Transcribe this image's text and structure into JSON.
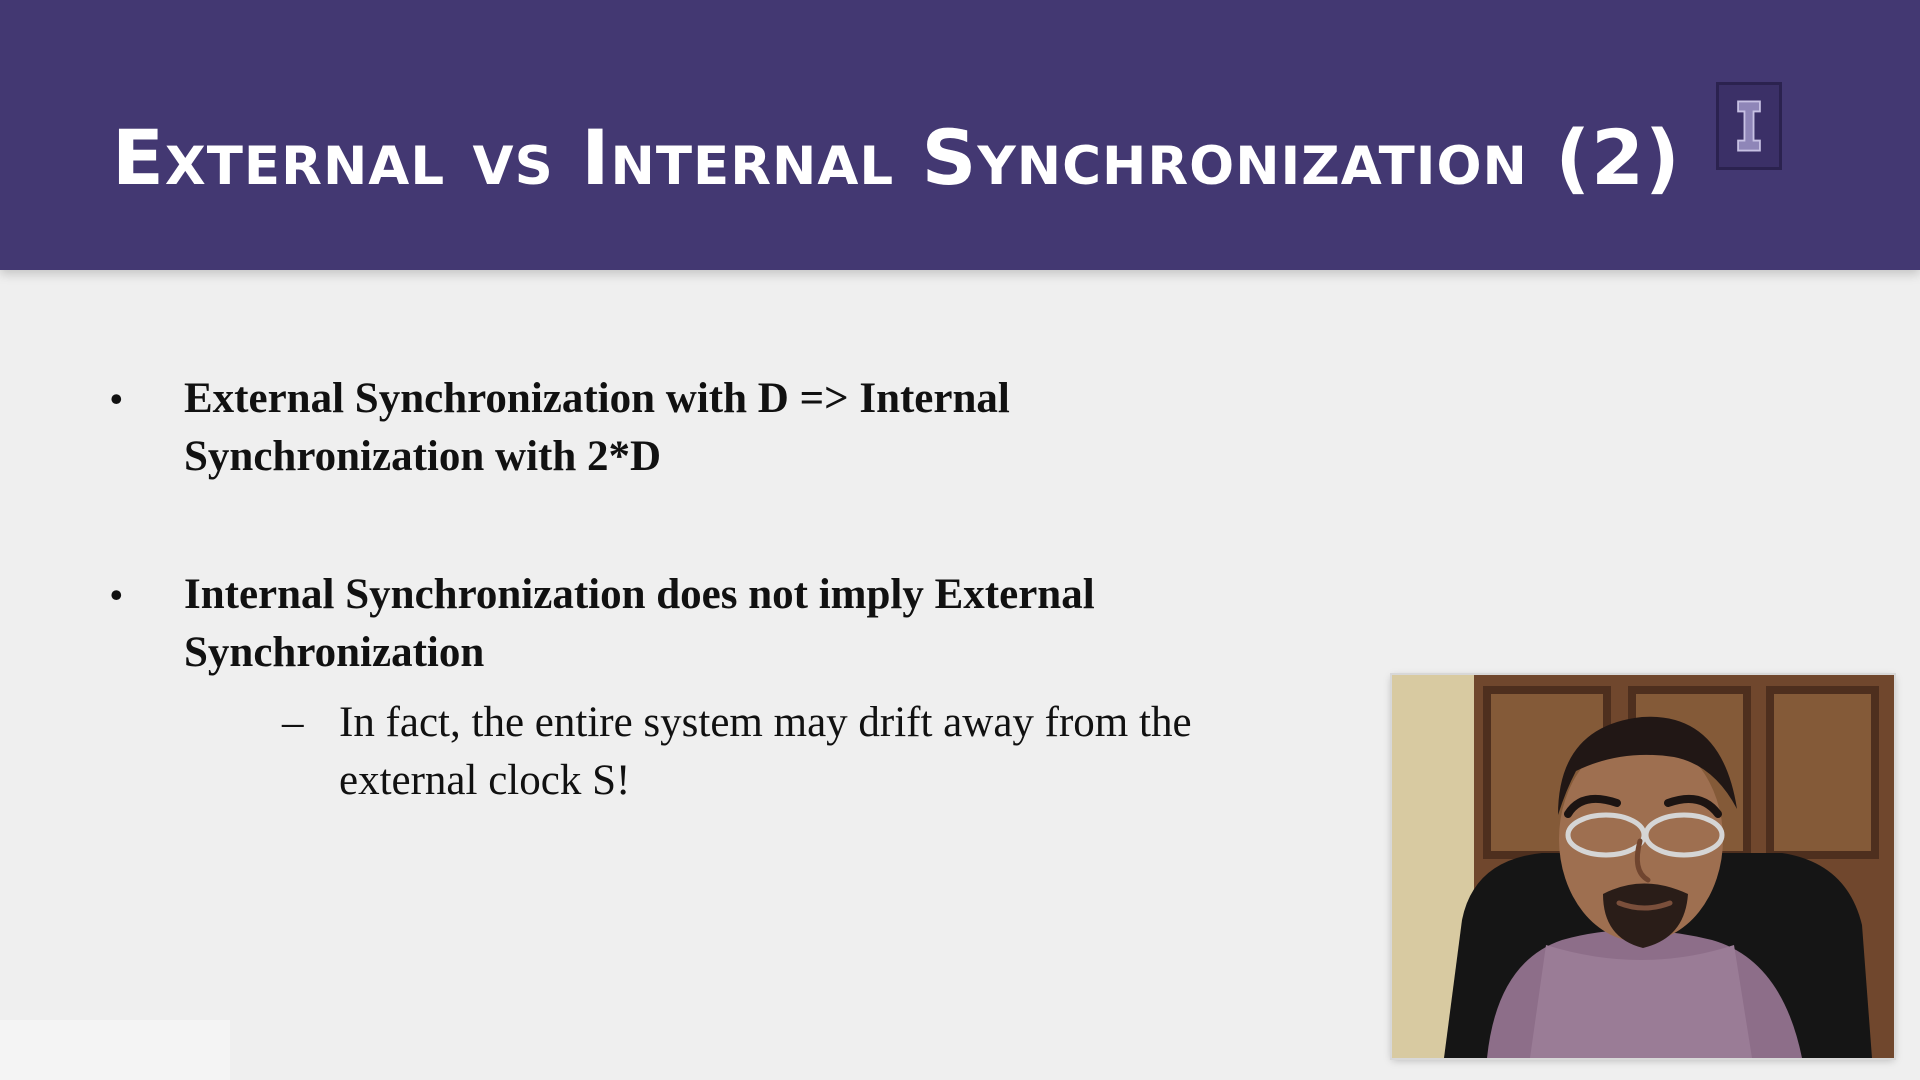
{
  "slide": {
    "title": "External vs Internal Synchronization (2)",
    "bullets": [
      {
        "marker": "•",
        "text": "External Synchronization with D => Internal Synchronization with 2*D"
      },
      {
        "marker": "•",
        "text": "Internal Synchronization does not imply External Synchronization",
        "subbullet": {
          "marker": "–",
          "text": "In fact, the entire system may drift away from the external clock S!"
        }
      }
    ]
  },
  "colors": {
    "header_background": "#433872",
    "slide_background": "#efefef",
    "text": "#111111"
  },
  "icons": {
    "logo": "university-i-logo-icon",
    "presenter": "presenter-webcam-video"
  }
}
